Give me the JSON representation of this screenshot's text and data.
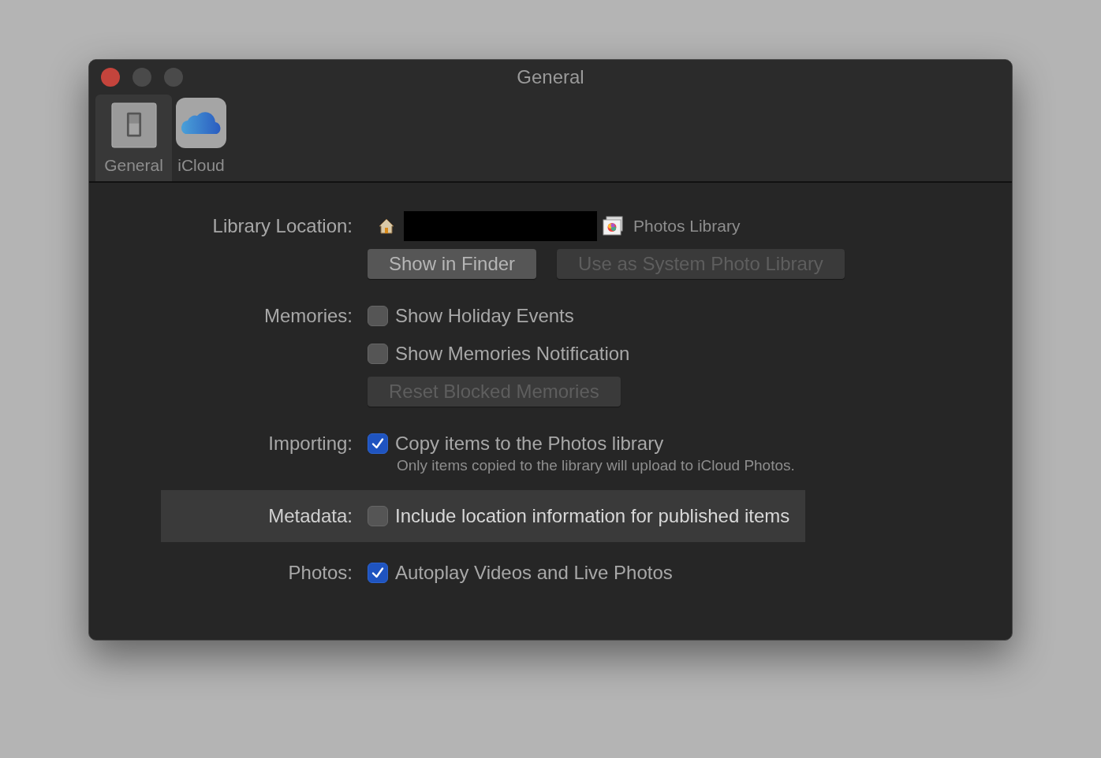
{
  "window": {
    "title": "General"
  },
  "toolbar": [
    {
      "label": "General",
      "selected": true,
      "kind": "switch"
    },
    {
      "label": "iCloud",
      "selected": false,
      "kind": "cloud"
    }
  ],
  "sections": [
    {
      "label": "Library Location:",
      "highlighted": false,
      "items": [
        {
          "kind": "path",
          "text": "Photos Library"
        },
        {
          "kind": "buttons",
          "buttons": [
            {
              "text": "Show in Finder",
              "disabled": false
            },
            {
              "text": "Use as System Photo Library",
              "disabled": true
            }
          ]
        }
      ]
    },
    {
      "label": "Memories:",
      "highlighted": false,
      "items": [
        {
          "kind": "checkbox",
          "text": "Show Holiday Events",
          "checked": false
        },
        {
          "kind": "checkbox",
          "text": "Show Memories Notification",
          "checked": false
        },
        {
          "kind": "buttons",
          "buttons": [
            {
              "text": "Reset Blocked Memories",
              "disabled": true
            }
          ]
        }
      ]
    },
    {
      "label": "Importing:",
      "highlighted": false,
      "items": [
        {
          "kind": "checkbox",
          "text": "Copy items to the Photos library",
          "checked": true
        },
        {
          "kind": "note",
          "text": "Only items copied to the library will upload to iCloud Photos."
        }
      ]
    },
    {
      "label": "Metadata:",
      "highlighted": true,
      "items": [
        {
          "kind": "checkbox",
          "text": "Include location information for published items",
          "checked": false
        }
      ]
    },
    {
      "label": "Photos:",
      "highlighted": false,
      "items": [
        {
          "kind": "checkbox",
          "text": "Autoplay Videos and Live Photos",
          "checked": true
        }
      ]
    }
  ]
}
